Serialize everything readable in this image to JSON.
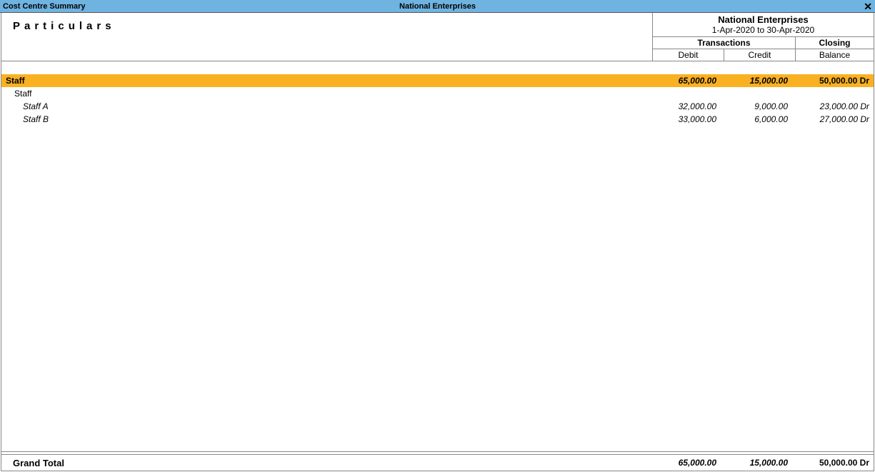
{
  "titlebar": {
    "screen_name": "Cost Centre Summary",
    "company": "National Enterprises",
    "close": "✕"
  },
  "header": {
    "particulars_label": "Particulars",
    "company": "National Enterprises",
    "period": "1-Apr-2020 to 30-Apr-2020",
    "transactions_label": "Transactions",
    "closing_label": "Closing",
    "balance_label": "Balance",
    "debit_label": "Debit",
    "credit_label": "Credit"
  },
  "group": {
    "name": "Staff",
    "debit": "65,000.00",
    "credit": "15,000.00",
    "balance": "50,000.00 Dr"
  },
  "subhead": {
    "name": "Staff"
  },
  "rows": [
    {
      "name": "Staff A",
      "debit": "32,000.00",
      "credit": "9,000.00",
      "balance": "23,000.00 Dr"
    },
    {
      "name": "Staff B",
      "debit": "33,000.00",
      "credit": "6,000.00",
      "balance": "27,000.00 Dr"
    }
  ],
  "footer": {
    "label": "Grand Total",
    "debit": "65,000.00",
    "credit": "15,000.00",
    "balance": "50,000.00 Dr"
  }
}
